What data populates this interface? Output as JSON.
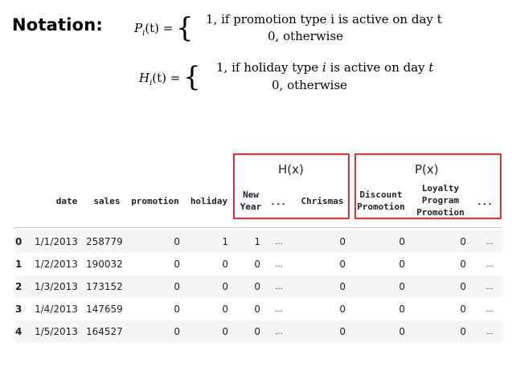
{
  "notation_label": "Notation:",
  "formulas": [
    {
      "lhs": "P_i(t) =",
      "lhs_base": "P",
      "lhs_sub": "i",
      "lhs_arg": "(t) =",
      "case_active": "1, if promotion type i is active on day t",
      "case_other": "0, otherwise"
    },
    {
      "lhs_base": "H",
      "lhs_sub": "i",
      "lhs_arg": "(t) =",
      "case_active_pre": "1, if holiday type ",
      "case_active_i": "i",
      "case_active_mid": " is active on day ",
      "case_active_t": "t",
      "case_other": "0, otherwise"
    }
  ],
  "groups": {
    "holiday": {
      "title": "H(x)",
      "border_color": "#e0313b"
    },
    "promotion": {
      "title": "P(x)",
      "border_color": "#e0313b"
    }
  },
  "table": {
    "columns": {
      "date": "date",
      "sales": "sales",
      "promotion": "promotion",
      "holiday": "holiday",
      "new_year_1": "New",
      "new_year_2": "Year",
      "ellipsis_h": "...",
      "chrismas": "Chrismas",
      "discount_1": "Discount",
      "discount_2": "Promotion",
      "loyalty_1": "Loyalty",
      "loyalty_2": "Program",
      "loyalty_3": "Promotion",
      "ellipsis_p": "..."
    },
    "rows": [
      {
        "idx": "0",
        "date": "1/1/2013",
        "sales": "258779",
        "promotion": "0",
        "holiday": "1",
        "new_year": "1",
        "ell1": "...",
        "chrismas": "0",
        "discount": "0",
        "loyalty": "0",
        "ell2": "..."
      },
      {
        "idx": "1",
        "date": "1/2/2013",
        "sales": "190032",
        "promotion": "0",
        "holiday": "0",
        "new_year": "0",
        "ell1": "...",
        "chrismas": "0",
        "discount": "0",
        "loyalty": "0",
        "ell2": "..."
      },
      {
        "idx": "2",
        "date": "1/3/2013",
        "sales": "173152",
        "promotion": "0",
        "holiday": "0",
        "new_year": "0",
        "ell1": "...",
        "chrismas": "0",
        "discount": "0",
        "loyalty": "0",
        "ell2": "..."
      },
      {
        "idx": "3",
        "date": "1/4/2013",
        "sales": "147659",
        "promotion": "0",
        "holiday": "0",
        "new_year": "0",
        "ell1": "...",
        "chrismas": "0",
        "discount": "0",
        "loyalty": "0",
        "ell2": "..."
      },
      {
        "idx": "4",
        "date": "1/5/2013",
        "sales": "164527",
        "promotion": "0",
        "holiday": "0",
        "new_year": "0",
        "ell1": "...",
        "chrismas": "0",
        "discount": "0",
        "loyalty": "0",
        "ell2": "..."
      }
    ],
    "stripe_color": "#f5f5f5"
  }
}
